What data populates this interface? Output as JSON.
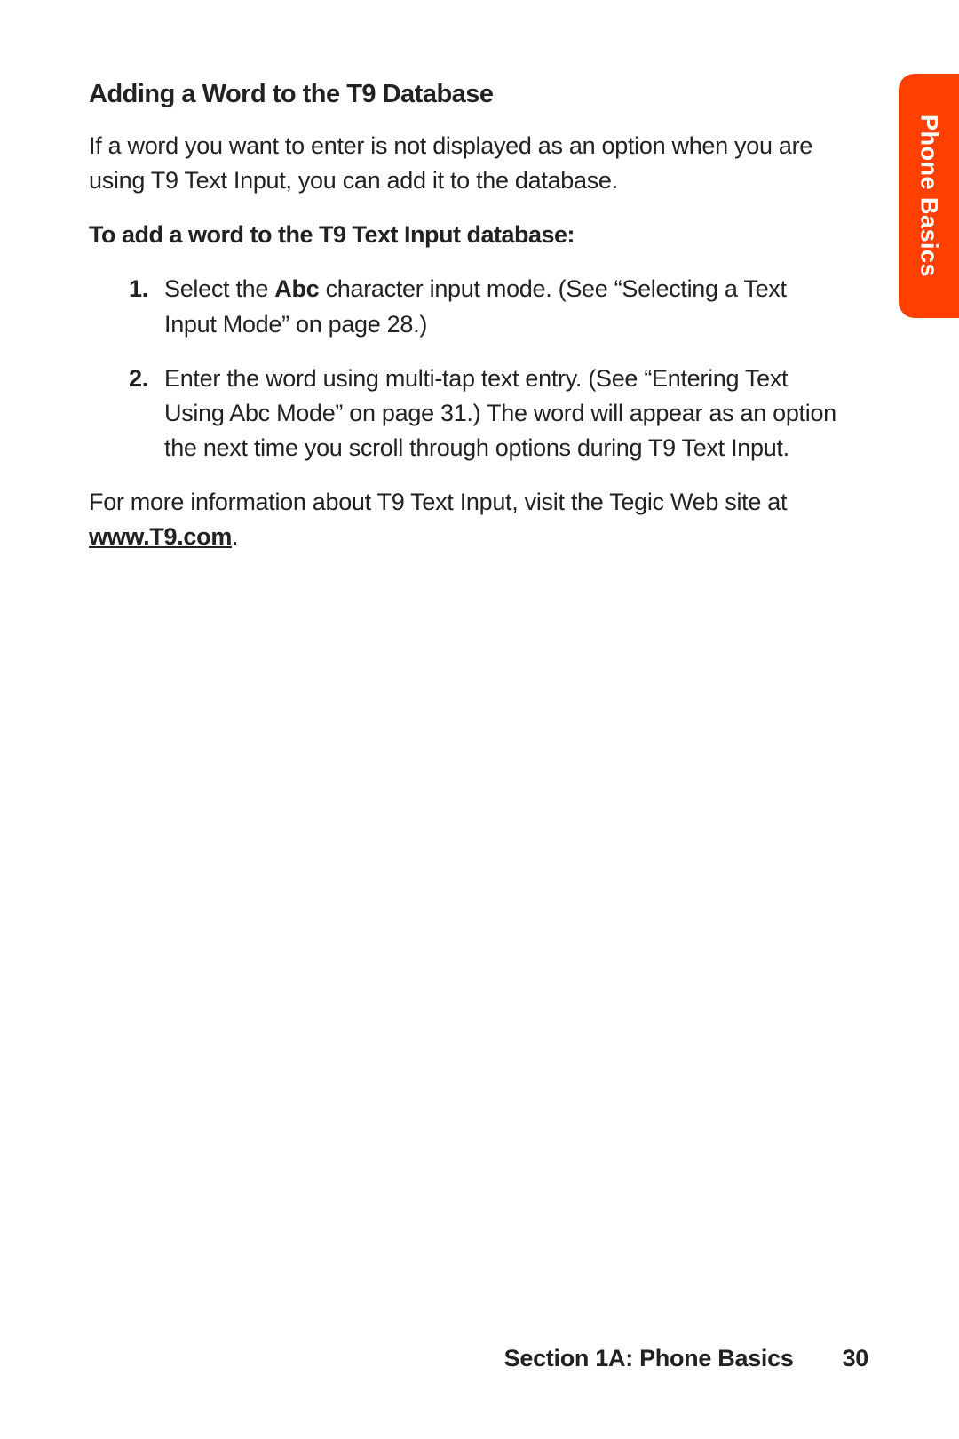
{
  "heading": "Adding a Word to the T9 Database",
  "intro": "If a word you want to enter is not displayed as an option when you are using T9 Text Input, you can add it to the database.",
  "subheading": "To add a word to the T9 Text Input database:",
  "steps": [
    {
      "num": "1.",
      "pre": "Select the ",
      "bold": "Abc",
      "post": " character input mode. (See “Selecting a Text Input Mode” on page 28.)"
    },
    {
      "num": "2.",
      "pre": "Enter the word using multi-tap text entry. (See “Entering Text Using Abc Mode” on page 31.) The word will appear as an option the next time you scroll through options during T9 Text Input.",
      "bold": "",
      "post": ""
    }
  ],
  "closing_pre": "For more information about T9 Text Input, visit the Tegic Web site at ",
  "closing_link": "www.T9.com",
  "closing_post": ".",
  "sidetab": "Phone Basics",
  "footer_section": "Section 1A: Phone Basics",
  "footer_page": "30"
}
